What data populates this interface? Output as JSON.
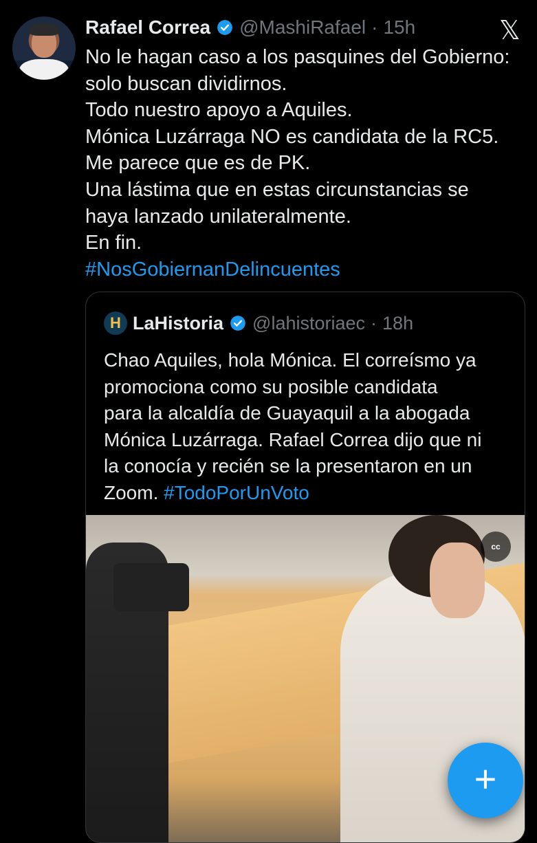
{
  "tweet": {
    "author_name": "Rafael Correa",
    "handle": "@MashiRafael",
    "separator": "·",
    "time": "15h",
    "text_lines": [
      "No le hagan caso a los pasquines del Gobierno:",
      "solo buscan dividirnos.",
      "Todo nuestro apoyo a Aquiles.",
      "Mónica Luzárraga NO es candidata de la RC5.",
      "Me parece que es de PK.",
      "Una lástima que en estas circunstancias se",
      "haya lanzado unilateralmente.",
      "En fin."
    ],
    "hashtag": "#NosGobiernanDelincuentes"
  },
  "top_right_logo": "𝕏",
  "quoted_tweet": {
    "logo_letter": "H",
    "author_name": "LaHistoria",
    "handle": "@lahistoriaec",
    "separator": "·",
    "time": "18h",
    "text_lines": [
      "Chao Aquiles, hola Mónica. El correísmo ya",
      "promociona como su posible candidata",
      "para la alcaldía de Guayaquil a la abogada",
      "Mónica Luzárraga. Rafael Correa dijo que ni",
      "la conocía y recién se la presentaron en un"
    ],
    "last_line_prefix": "Zoom. ",
    "hashtag": "#TodoPorUnVoto",
    "cc_label": "cc"
  },
  "fab": {
    "label": "+"
  },
  "colors": {
    "accent": "#1d9bf0",
    "background": "#000000",
    "muted": "#71767b",
    "text": "#e7e9ea"
  },
  "icons": [
    "verified-badge-icon",
    "x-logo-icon",
    "closed-captions-icon",
    "plus-icon"
  ]
}
